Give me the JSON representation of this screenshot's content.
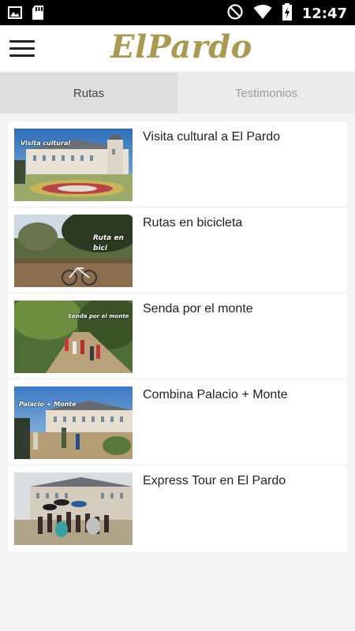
{
  "status_bar": {
    "time": "12:47",
    "icons": [
      "image-icon",
      "sd-card-icon",
      "do-not-disturb-icon",
      "wifi-icon",
      "battery-charging-icon"
    ]
  },
  "app_bar": {
    "menu_icon": "hamburger-menu-icon",
    "brand": "ElPardo"
  },
  "tabs": [
    {
      "label": "Rutas",
      "active": true
    },
    {
      "label": "Testimonios",
      "active": false
    }
  ],
  "routes": [
    {
      "title": "Visita cultural a El Pardo",
      "caption": "Visita cultural"
    },
    {
      "title": "Rutas en bicicleta",
      "caption": "Ruta en bici"
    },
    {
      "title": "Senda por el monte",
      "caption": "Senda por el monte"
    },
    {
      "title": "Combina Palacio + Monte",
      "caption": "Palacio + Monte"
    },
    {
      "title": "Express Tour en El Pardo",
      "caption": ""
    }
  ]
}
